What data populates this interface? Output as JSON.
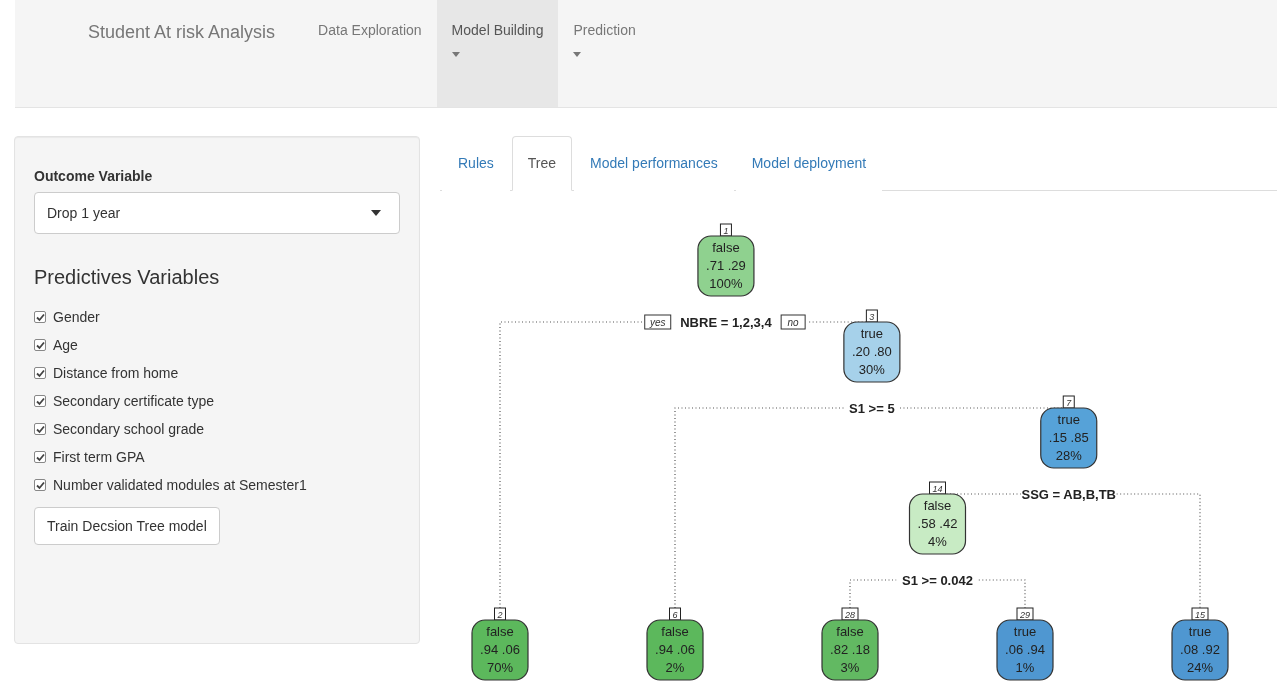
{
  "navbar": {
    "brand": "Student At risk Analysis",
    "items": [
      {
        "label": "Data Exploration",
        "dropdown": false,
        "selected": false
      },
      {
        "label": "Model Building",
        "dropdown": true,
        "selected": true
      },
      {
        "label": "Prediction",
        "dropdown": true,
        "selected": false
      }
    ]
  },
  "sidebar": {
    "outcome": {
      "label": "Outcome Variable",
      "value": "Drop 1 year"
    },
    "predictors_title": "Predictives Variables",
    "predictors": [
      {
        "label": "Gender",
        "checked": true
      },
      {
        "label": "Age",
        "checked": true
      },
      {
        "label": "Distance from home",
        "checked": true
      },
      {
        "label": "Secondary certificate type",
        "checked": true
      },
      {
        "label": "Secondary school grade",
        "checked": true
      },
      {
        "label": "First term GPA",
        "checked": true
      },
      {
        "label": "Number validated modules at Semester1",
        "checked": true
      }
    ],
    "button": "Train Decsion Tree model"
  },
  "tabs": [
    {
      "label": "Rules",
      "selected": false
    },
    {
      "label": "Tree",
      "selected": true
    },
    {
      "label": "Model performances",
      "selected": false
    },
    {
      "label": "Model deployment",
      "selected": false
    }
  ],
  "tree": {
    "id": "1",
    "class": "false",
    "probs": ".71 .29",
    "percent": "100%",
    "color": "#8fd18f",
    "split": "NBRE = 1,2,3,4",
    "yes": "yes",
    "no": "no",
    "children": [
      {
        "id": "2",
        "class": "false",
        "probs": ".94 .06",
        "percent": "70%",
        "color": "#5cb85c"
      },
      {
        "id": "3",
        "class": "true",
        "probs": ".20 .80",
        "percent": "30%",
        "color": "#a6d1ea",
        "split": "S1 >= 5",
        "children": [
          {
            "id": "6",
            "class": "false",
            "probs": ".94 .06",
            "percent": "2%",
            "color": "#5cb85c"
          },
          {
            "id": "7",
            "class": "true",
            "probs": ".15 .85",
            "percent": "28%",
            "color": "#56a2d8",
            "split": "SSG = AB,B,TB",
            "children": [
              {
                "id": "14",
                "class": "false",
                "probs": ".58 .42",
                "percent": "4%",
                "color": "#c8ebc4",
                "split": "S1 >= 0.042",
                "children": [
                  {
                    "id": "28",
                    "class": "false",
                    "probs": ".82 .18",
                    "percent": "3%",
                    "color": "#62b962"
                  },
                  {
                    "id": "29",
                    "class": "true",
                    "probs": ".06 .94",
                    "percent": "1%",
                    "color": "#4f97d1"
                  }
                ]
              },
              {
                "id": "15",
                "class": "true",
                "probs": ".08 .92",
                "percent": "24%",
                "color": "#4f97d1"
              }
            ]
          }
        ]
      }
    ]
  }
}
